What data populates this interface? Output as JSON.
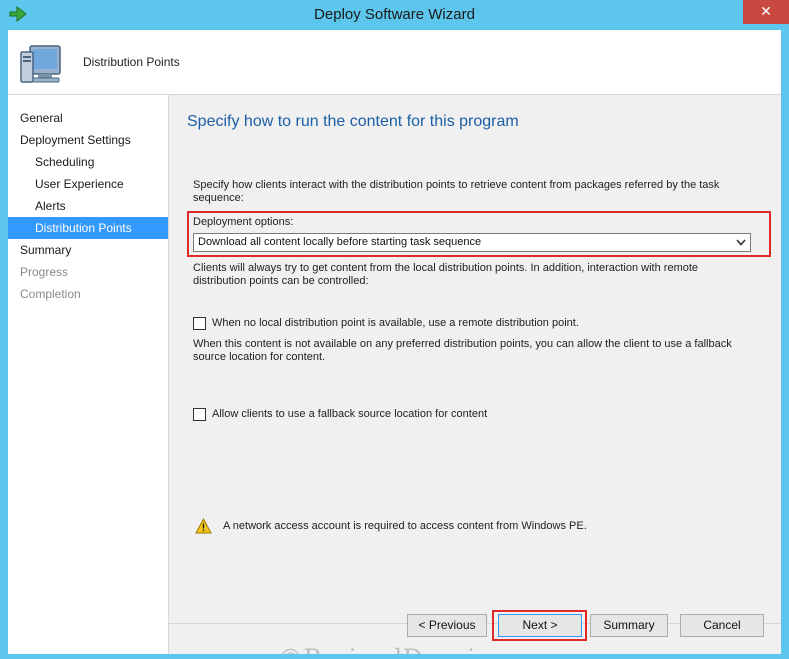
{
  "window": {
    "title": "Deploy Software Wizard",
    "close_symbol": "✕"
  },
  "header": {
    "page_title": "Distribution Points",
    "icon": "computer-icon"
  },
  "nav": {
    "items": [
      {
        "label": "General"
      },
      {
        "label": "Deployment Settings"
      },
      {
        "label": "Scheduling"
      },
      {
        "label": "User Experience"
      },
      {
        "label": "Alerts"
      },
      {
        "label": "Distribution Points"
      },
      {
        "label": "Summary"
      },
      {
        "label": "Progress"
      },
      {
        "label": "Completion"
      }
    ]
  },
  "main": {
    "heading": "Specify how to run the content for this program",
    "description": "Specify how clients interact with the distribution points to retrieve content from packages referred by the task sequence:",
    "deployment_options_label": "Deployment options:",
    "deployment_options_value": "Download all content locally before starting task sequence",
    "remote_note": "Clients will always try to get content from the local distribution points. In addition, interaction with remote distribution points can be controlled:",
    "remote_checkbox_label": "When no local distribution point is available, use a remote distribution point.",
    "fallback_note": "When this content is not available on any preferred distribution points, you can allow the client to use a fallback source location for content.",
    "fallback_checkbox_label": "Allow clients to use a fallback source location for content",
    "warning_text": "A network access account is required to access content from Windows PE."
  },
  "buttons": {
    "previous": "< Previous",
    "next": "Next >",
    "summary": "Summary",
    "cancel": "Cancel"
  },
  "watermark": "©PrajwalDesai.com",
  "colors": {
    "titlebar": "#5cc6ec",
    "close": "#c9483f",
    "accent": "#3399ff",
    "heading": "#1c5fa6",
    "highlight": "#e02a2a"
  }
}
